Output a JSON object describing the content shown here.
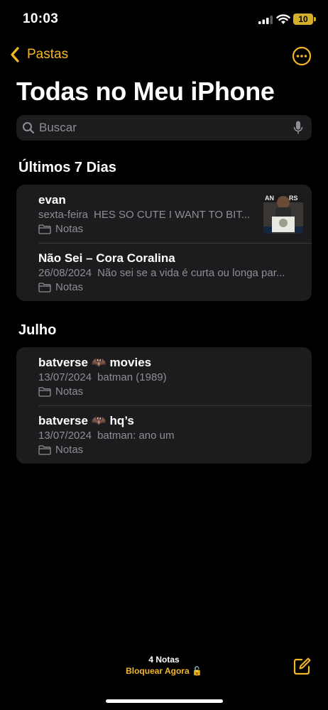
{
  "status": {
    "time": "10:03",
    "battery": "10"
  },
  "nav": {
    "back_label": "Pastas"
  },
  "page_title": "Todas no Meu iPhone",
  "search": {
    "placeholder": "Buscar"
  },
  "sections": [
    {
      "header": "Últimos 7 Dias",
      "notes": [
        {
          "title": "evan",
          "date": "sexta-feira",
          "preview": "HES SO CUTE I WANT TO BIT...",
          "folder": "Notas",
          "has_thumbnail": true
        },
        {
          "title": "Não Sei – Cora Coralina",
          "date": "26/08/2024",
          "preview": "Não sei se a vida é curta ou longa par...",
          "folder": "Notas"
        }
      ]
    },
    {
      "header": "Julho",
      "notes": [
        {
          "title": "batverse 🦇 movies",
          "date": "13/07/2024",
          "preview": "batman (1989)",
          "folder": "Notas"
        },
        {
          "title": "batverse 🦇 hq’s",
          "date": "13/07/2024",
          "preview": "batman: ano um",
          "folder": "Notas"
        }
      ]
    }
  ],
  "footer": {
    "count": "4 Notas",
    "lock": "Bloquear Agora 🔓"
  },
  "colors": {
    "accent": "#f3b725",
    "card": "#1c1c1e",
    "secondary_text": "#8e8e93"
  }
}
